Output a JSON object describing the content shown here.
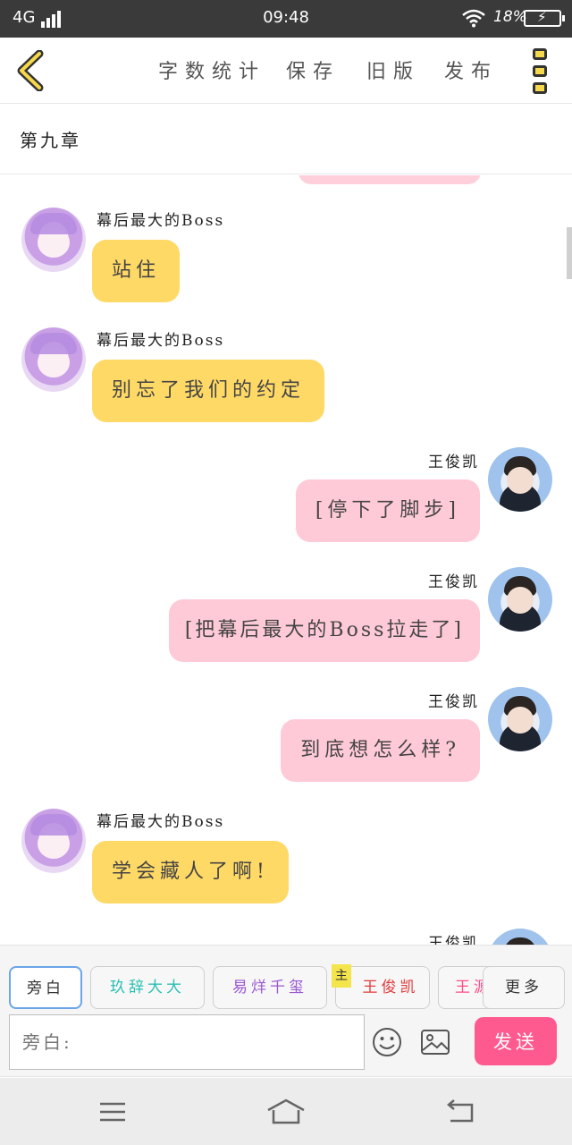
{
  "status_bar": {
    "network": "4G",
    "time": "09:48",
    "battery": "18%"
  },
  "toolbar": {
    "items": [
      "字数统计",
      "保存",
      "旧版",
      "发布"
    ],
    "icons": {
      "back": "chevron-left-icon",
      "menu": "more-menu-icon"
    },
    "accent": "#f5d84b"
  },
  "chapter": {
    "title": "第九章"
  },
  "messages": [
    {
      "side": "left",
      "name": "幕后最大的Boss",
      "text": "站住"
    },
    {
      "side": "left",
      "name": "幕后最大的Boss",
      "text": "别忘了我们的约定"
    },
    {
      "side": "right",
      "name": "王俊凯",
      "text": "[停下了脚步]"
    },
    {
      "side": "right",
      "name": "王俊凯",
      "text": "[把幕后最大的Boss拉走了]"
    },
    {
      "side": "right",
      "name": "王俊凯",
      "text": "到底想怎么样?"
    },
    {
      "side": "left",
      "name": "幕后最大的Boss",
      "text": "学会藏人了啊!"
    },
    {
      "side": "right",
      "name": "王俊凯",
      "text": ""
    }
  ],
  "roles": {
    "items": [
      {
        "label": "旁白",
        "color": "#333333"
      },
      {
        "label": "玖辞大大",
        "color": "#2bbfb3"
      },
      {
        "label": "易烊千玺",
        "color": "#9b59d0"
      },
      {
        "label": "王俊凯",
        "color": "#e03b3b"
      },
      {
        "label": "王源",
        "color": "#ff4f8b"
      }
    ],
    "main_badge": "主",
    "more": "更多"
  },
  "composer": {
    "placeholder": "旁白:",
    "send": "发送",
    "icons": {
      "emoji": "emoji-icon",
      "image": "image-icon"
    }
  },
  "colors": {
    "left_bubble": "#ffd966",
    "right_bubble": "#ffcad8",
    "send_button": "#ff5a8f"
  },
  "nav_bar": {
    "icons": [
      "menu-icon",
      "home-icon",
      "back-icon"
    ]
  }
}
